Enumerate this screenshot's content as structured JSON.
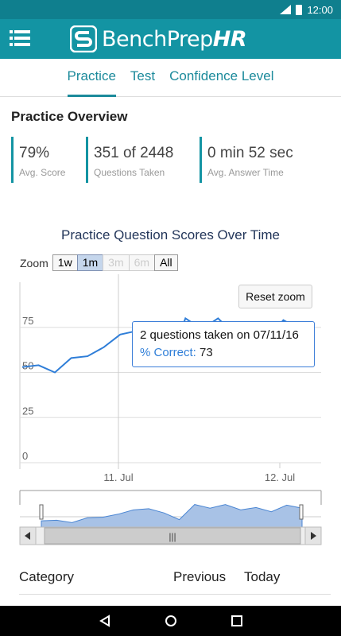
{
  "status": {
    "signal_label": "3G",
    "time": "12:00"
  },
  "app": {
    "logo_text": "BenchPrep",
    "logo_suffix": "HR"
  },
  "tabs": [
    {
      "label": "Practice",
      "active": true
    },
    {
      "label": "Test",
      "active": false
    },
    {
      "label": "Confidence Level",
      "active": false
    }
  ],
  "overview": {
    "title": "Practice Overview",
    "stats": [
      {
        "value": "79%",
        "label": "Avg. Score"
      },
      {
        "value": "351 of 2448",
        "label": "Questions Taken"
      },
      {
        "value": "0 min 52 sec",
        "label": "Avg. Answer Time"
      }
    ]
  },
  "chart": {
    "title": "Practice Question Scores Over Time",
    "zoom_label": "Zoom",
    "zoom_buttons": [
      {
        "label": "1w",
        "state": "normal"
      },
      {
        "label": "1m",
        "state": "selected"
      },
      {
        "label": "3m",
        "state": "disabled"
      },
      {
        "label": "6m",
        "state": "disabled"
      },
      {
        "label": "All",
        "state": "normal"
      }
    ],
    "reset_label": "Reset zoom",
    "tooltip": {
      "line1": "2 questions taken on 07/11/16",
      "key": "% Correct:",
      "value": "73"
    },
    "accent": "#1b6bd0",
    "scroll_thumb": "|||"
  },
  "chart_data": {
    "type": "line",
    "ylim": [
      0,
      100
    ],
    "y_ticks": [
      "0",
      "25",
      "50",
      "75"
    ],
    "x_ticks": [
      "11. Jul",
      "12. Jul"
    ],
    "series": [
      {
        "values": [
          53,
          54,
          50,
          58,
          59,
          64,
          71,
          73,
          66,
          55,
          80,
          74,
          80,
          71,
          75,
          68,
          79,
          74
        ]
      }
    ],
    "highlight_index": 7
  },
  "category_table": {
    "headers": [
      "Category",
      "Previous",
      "Today"
    ]
  },
  "nav": {
    "back": "back-icon",
    "home": "home-icon",
    "recent": "recent-icon"
  }
}
